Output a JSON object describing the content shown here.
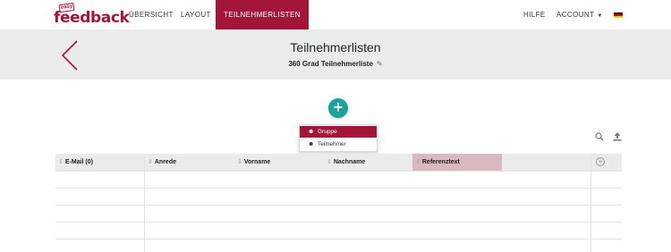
{
  "brand": {
    "badge": "easy",
    "wordmark": "feedback"
  },
  "nav": {
    "items": [
      {
        "label": "ÜBERSICHT"
      },
      {
        "label": "LAYOUT"
      },
      {
        "label": "TEILNEHMERLISTEN"
      }
    ],
    "help": "HILFE",
    "account": "ACCOUNT",
    "language_flag": "de-flag-icon"
  },
  "header": {
    "title": "Teilnehmerlisten",
    "subtitle": "360 Grad Teilnehmerliste"
  },
  "add_menu": {
    "items": [
      {
        "label": "Gruppe",
        "icon": "person-icon"
      },
      {
        "label": "Teilnehmer",
        "icon": "person-icon"
      }
    ]
  },
  "table": {
    "columns": [
      {
        "label": "E-Mail (0)"
      },
      {
        "label": "Anrede"
      },
      {
        "label": "Vorname"
      },
      {
        "label": "Nachname"
      },
      {
        "label": "Referenztext"
      }
    ]
  },
  "colors": {
    "accent": "#a3163a",
    "teal": "#1aa39a",
    "header_bg": "#ebebeb",
    "highlight_col": "#d9b8c2"
  }
}
